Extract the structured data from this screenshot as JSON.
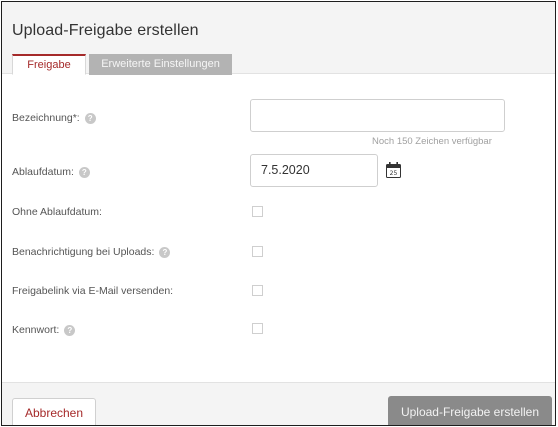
{
  "dialog": {
    "title": "Upload-Freigabe erstellen",
    "tabs": [
      {
        "label": "Freigabe",
        "active": true
      },
      {
        "label": "Erweiterte Einstellungen",
        "active": false
      }
    ]
  },
  "form": {
    "name_label": "Bezeichnung*:",
    "name_value": "",
    "name_hint": "Noch 150 Zeichen verfügbar",
    "expiry_label": "Ablaufdatum:",
    "expiry_value": "7.5.2020",
    "calendar_day": "25",
    "no_expiry_label": "Ohne Ablaufdatum:",
    "no_expiry_checked": false,
    "notify_label": "Benachrichtigung bei Uploads:",
    "notify_checked": false,
    "email_label": "Freigabelink via E-Mail versenden:",
    "email_checked": false,
    "password_label": "Kennwort:",
    "password_checked": false,
    "help_glyph": "?"
  },
  "footer": {
    "cancel_label": "Abbrechen",
    "submit_label": "Upload-Freigabe erstellen"
  },
  "colors": {
    "accent": "#a52a2a",
    "submit_bg": "#8a8a8a",
    "inactive_tab_bg": "#b3b3b3"
  }
}
